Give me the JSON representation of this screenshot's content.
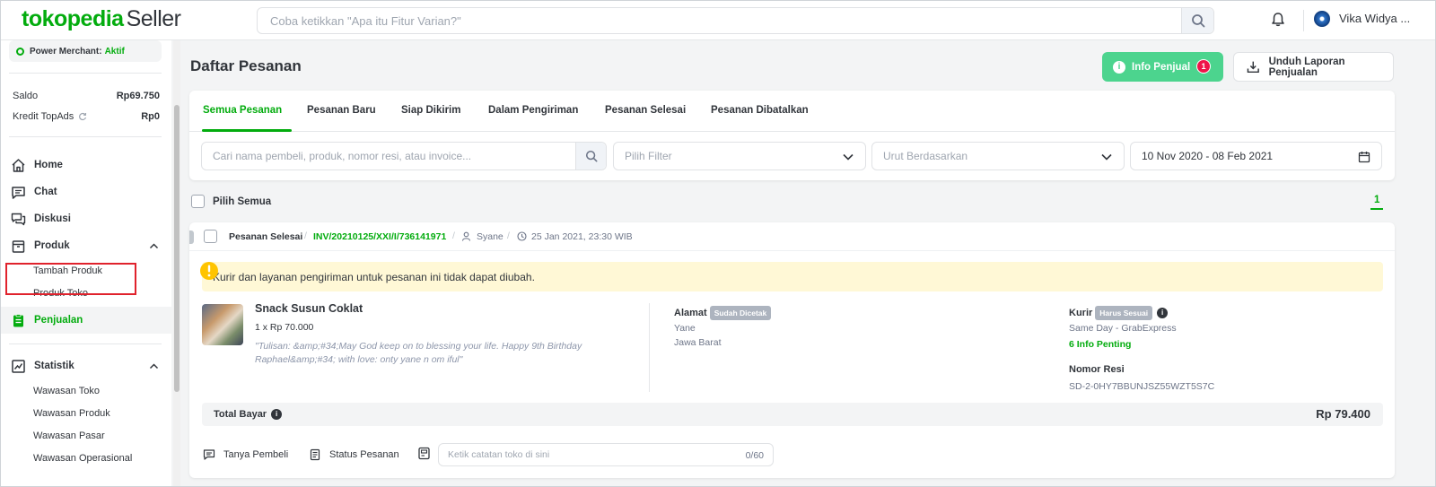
{
  "header": {
    "logo_brand": "tokopedia",
    "logo_suffix": "Seller",
    "search_placeholder": "Coba ketikkan \"Apa itu Fitur Varian?\"",
    "user_name": "Vika Widya ..."
  },
  "sidebar": {
    "power_merchant_label": "Power Merchant:",
    "power_merchant_status": "Aktif",
    "saldo_label": "Saldo",
    "saldo_value": "Rp69.750",
    "kredit_label": "Kredit TopAds",
    "kredit_value": "Rp0",
    "nav": {
      "home": "Home",
      "chat": "Chat",
      "diskusi": "Diskusi",
      "produk": "Produk",
      "tambah_produk": "Tambah Produk",
      "produk_toko": "Produk Toko",
      "penjualan": "Penjualan",
      "statistik": "Statistik",
      "wawasan_toko": "Wawasan Toko",
      "wawasan_produk": "Wawasan Produk",
      "wawasan_pasar": "Wawasan Pasar",
      "wawasan_operasional": "Wawasan Operasional"
    }
  },
  "main": {
    "title": "Daftar Pesanan",
    "info_button": "Info Penjual",
    "info_badge": "1",
    "download_button": "Unduh Laporan Penjualan",
    "tabs": [
      {
        "label": "Semua Pesanan"
      },
      {
        "label": "Pesanan Baru"
      },
      {
        "label": "Siap Dikirim"
      },
      {
        "label": "Dalam Pengiriman"
      },
      {
        "label": "Pesanan Selesai"
      },
      {
        "label": "Pesanan Dibatalkan"
      }
    ],
    "filters": {
      "search_placeholder": "Cari nama pembeli, produk, nomor resi, atau invoice...",
      "filter_placeholder": "Pilih Filter",
      "sort_placeholder": "Urut Berdasarkan",
      "date_range": "10 Nov 2020 - 08 Feb 2021"
    },
    "select_all": "Pilih Semua",
    "page_number": "1"
  },
  "order": {
    "status": "Pesanan Selesai",
    "invoice": "INV/20210125/XXI/I/736141971",
    "buyer": "Syane",
    "datetime": "25 Jan 2021, 23:30 WIB",
    "warning": "Kurir dan layanan pengiriman untuk pesanan ini tidak dapat diubah.",
    "product_name": "Snack Susun Coklat",
    "product_qty": "1 x Rp 70.000",
    "product_note": "\"Tulisan: &amp;#34;May God keep on to blessing your life. Happy 9th Birthday Raphael&amp;#34; with love: onty yane n om iful\"",
    "address_label": "Alamat",
    "address_chip": "Sudah Dicetak",
    "address_name": "Yane",
    "address_region": "Jawa Barat",
    "courier_label": "Kurir",
    "courier_chip": "Harus Sesuai",
    "courier_service": "Same Day - GrabExpress",
    "info_penting": "6 Info Penting",
    "resi_label": "Nomor Resi",
    "resi_value": "SD-2-0HY7BBUNJSZ55WZT5S7C",
    "total_label": "Total Bayar",
    "total_value": "Rp 79.400",
    "ask_buyer": "Tanya Pembeli",
    "order_status_link": "Status Pesanan",
    "note_placeholder": "Ketik catatan toko di sini",
    "note_counter": "0/60"
  }
}
